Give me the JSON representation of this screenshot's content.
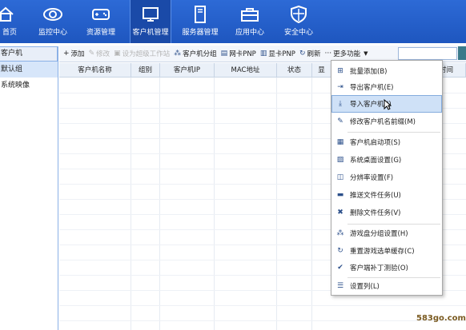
{
  "nav": {
    "items": [
      {
        "label": "首页",
        "icon": "home-icon"
      },
      {
        "label": "监控中心",
        "icon": "eye-icon"
      },
      {
        "label": "资源管理",
        "icon": "gamepad-icon"
      },
      {
        "label": "客户机管理",
        "icon": "monitor-icon",
        "active": true
      },
      {
        "label": "服务器管理",
        "icon": "server-icon"
      },
      {
        "label": "应用中心",
        "icon": "toolbox-icon"
      },
      {
        "label": "安全中心",
        "icon": "shield-icon"
      }
    ]
  },
  "sidebar": {
    "title": "客户机",
    "items": [
      "默认组",
      "系统映像"
    ]
  },
  "toolbar": {
    "add": "添加",
    "edit": "修改",
    "set_workstation": "设为超级工作站",
    "client_group": "客户机分组",
    "nic_pnp": "网卡PNP",
    "display_pnp": "显卡PNP",
    "refresh": "刷新",
    "more": "更多功能"
  },
  "table": {
    "columns": [
      "客户机名称",
      "组别",
      "客户机IP",
      "MAC地址",
      "状态",
      "显",
      "",
      "时间"
    ]
  },
  "context_menu": {
    "items": [
      {
        "label": "批量添加(B)",
        "icon": "batch-add-icon"
      },
      {
        "label": "导出客户机(E)",
        "icon": "export-icon"
      },
      {
        "label": "导入客户机(I)",
        "icon": "import-icon",
        "highlighted": true
      },
      {
        "label": "修改客户机名前缀(M)",
        "icon": "pen-icon"
      },
      {
        "label": "客户机启动项(S)",
        "icon": "boot-list-icon"
      },
      {
        "label": "系统桌面设置(G)",
        "icon": "desktop-icon"
      },
      {
        "label": "分辨率设置(F)",
        "icon": "resolution-icon"
      },
      {
        "label": "推送文件任务(U)",
        "icon": "push-file-icon"
      },
      {
        "label": "删除文件任务(V)",
        "icon": "delete-icon"
      },
      {
        "label": "游戏盘分组设置(H)",
        "icon": "group-icon"
      },
      {
        "label": "重置游戏选单缓存(C)",
        "icon": "reset-icon"
      },
      {
        "label": "客户端补丁测验(O)",
        "icon": "patch-icon"
      },
      {
        "label": "设置列(L)",
        "icon": "columns-icon"
      }
    ]
  },
  "watermark": "583go.com",
  "colors": {
    "topbar": "#2360cc",
    "highlight": "#cfe1f7",
    "grid_border": "#c8d4e4"
  }
}
